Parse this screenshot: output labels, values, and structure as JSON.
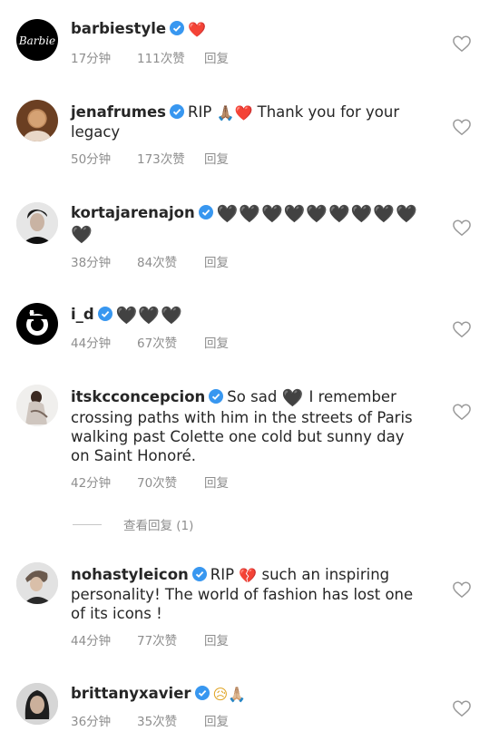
{
  "comments": [
    {
      "username": "barbiestyle",
      "text_before": "",
      "emoji": "❤️",
      "text_after": "",
      "text_line2": "",
      "time": "17分钟",
      "likes": "111次赞",
      "reply": "回复",
      "avatar": "barbie-logo"
    },
    {
      "username": "jenafrumes",
      "text_before": "RIP",
      "emoji": "🙏🏽❤️",
      "text_after": "Thank you for your",
      "text_line2": "legacy",
      "time": "50分钟",
      "likes": "173次赞",
      "reply": "回复",
      "avatar": "photo"
    },
    {
      "username": "kortajarenajon",
      "text_before": "",
      "emoji": "🖤🖤🖤🖤🖤🖤🖤🖤🖤",
      "text_after": "",
      "text_line2": "🖤",
      "time": "38分钟",
      "likes": "84次赞",
      "reply": "回复",
      "avatar": "photo"
    },
    {
      "username": "i_d",
      "text_before": "",
      "emoji": "🖤🖤🖤",
      "text_after": "",
      "text_line2": "",
      "time": "44分钟",
      "likes": "67次赞",
      "reply": "回复",
      "avatar": "id-logo"
    },
    {
      "username": "itskcconcepcion",
      "text_before": "So sad",
      "emoji": "🖤",
      "text_after": "I remember",
      "text_line2": "crossing paths with him in the streets of Paris",
      "text_line3": "walking past Colette one cold but sunny day",
      "text_line4": "on Saint Honoré.",
      "time": "42分钟",
      "likes": "70次赞",
      "reply": "回复",
      "avatar": "photo"
    },
    {
      "username": "nohastyleicon",
      "text_before": "RIP",
      "emoji": "💔",
      "text_after": "such an inspiring",
      "text_line2": "personality! The world of fashion has lost one",
      "text_line3": "of its icons !",
      "time": "44分钟",
      "likes": "77次赞",
      "reply": "回复",
      "avatar": "photo"
    },
    {
      "username": "brittanyxavier",
      "text_before": "",
      "emoji": "😥🙏🏼",
      "text_after": "",
      "text_line2": "",
      "time": "36分钟",
      "likes": "35次赞",
      "reply": "回复",
      "avatar": "photo"
    }
  ],
  "view_replies": "查看回复 (1)",
  "barbie_logo_text": "Barbie",
  "colors": {
    "verified": "#3897f0",
    "meta": "#8e8e8e",
    "text": "#262626"
  }
}
